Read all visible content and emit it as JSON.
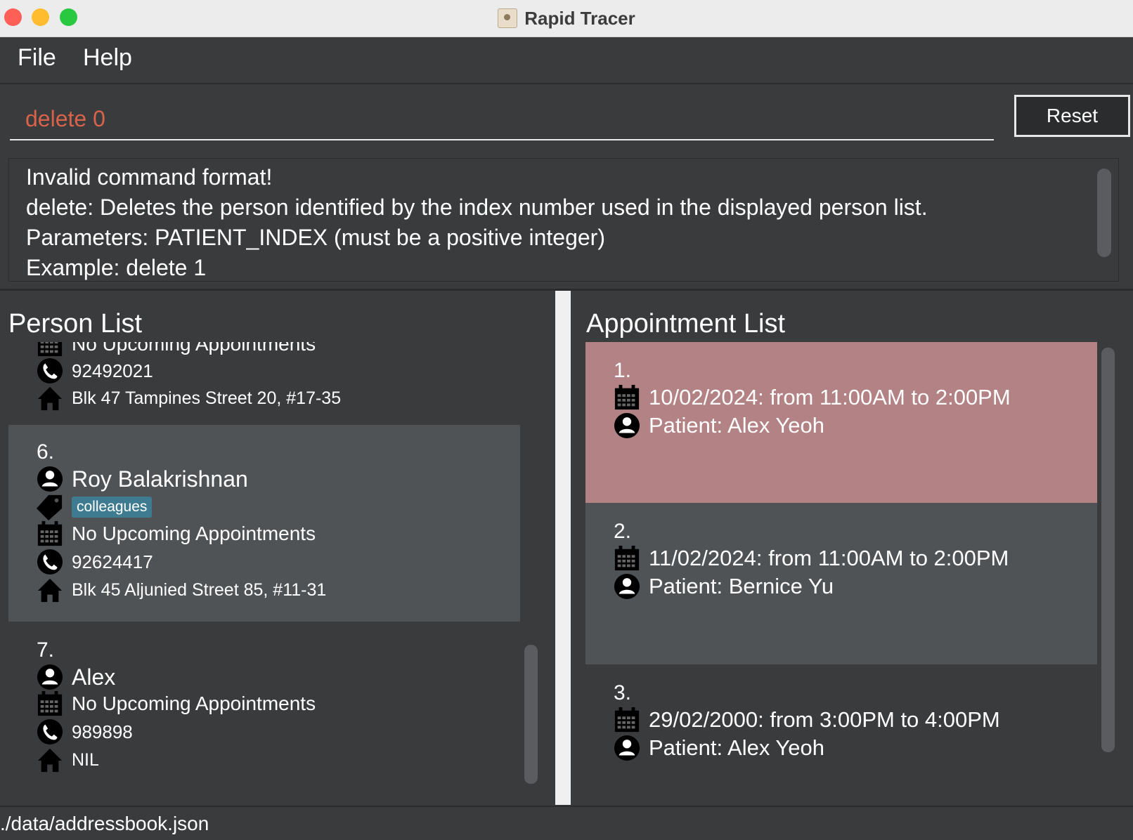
{
  "window": {
    "title": "Rapid Tracer"
  },
  "menu": {
    "file": "File",
    "help": "Help"
  },
  "command": {
    "value": "delete 0",
    "reset_label": "Reset"
  },
  "result": {
    "lines": [
      "Invalid command format!",
      "delete: Deletes the person identified by the index number used in the displayed person list.",
      "Parameters: PATIENT_INDEX (must be a positive integer)",
      "Example: delete 1"
    ]
  },
  "person_panel": {
    "title": "Person List",
    "partial_card": {
      "appointments": "No Upcoming Appointments",
      "phone": "92492021",
      "address": "Blk 47 Tampines Street 20, #17-35"
    },
    "cards": [
      {
        "index": "6.",
        "name": "Roy Balakrishnan",
        "tag": "colleagues",
        "appointments": "No Upcoming Appointments",
        "phone": "92624417",
        "address": "Blk 45 Aljunied Street 85, #11-31"
      },
      {
        "index": "7.",
        "name": "Alex",
        "appointments": "No Upcoming Appointments",
        "phone": "989898",
        "address": "NIL"
      }
    ]
  },
  "appointment_panel": {
    "title": "Appointment List",
    "cards": [
      {
        "index": "1.",
        "time": "10/02/2024: from 11:00AM to 2:00PM",
        "patient": "Patient: Alex Yeoh"
      },
      {
        "index": "2.",
        "time": "11/02/2024: from 11:00AM to 2:00PM",
        "patient": "Patient: Bernice Yu"
      },
      {
        "index": "3.",
        "time": "29/02/2000: from 3:00PM to 4:00PM",
        "patient": "Patient: Alex Yeoh"
      }
    ]
  },
  "status": {
    "path": "./data/addressbook.json"
  },
  "colors": {
    "background": "#3a3b3d",
    "card_selected_person": "#4f5356",
    "card_selected_appointment": "#b28285",
    "card_appointment_alt": "#4f5356",
    "tag": "#3e7b91",
    "command_text": "#d8634a"
  }
}
